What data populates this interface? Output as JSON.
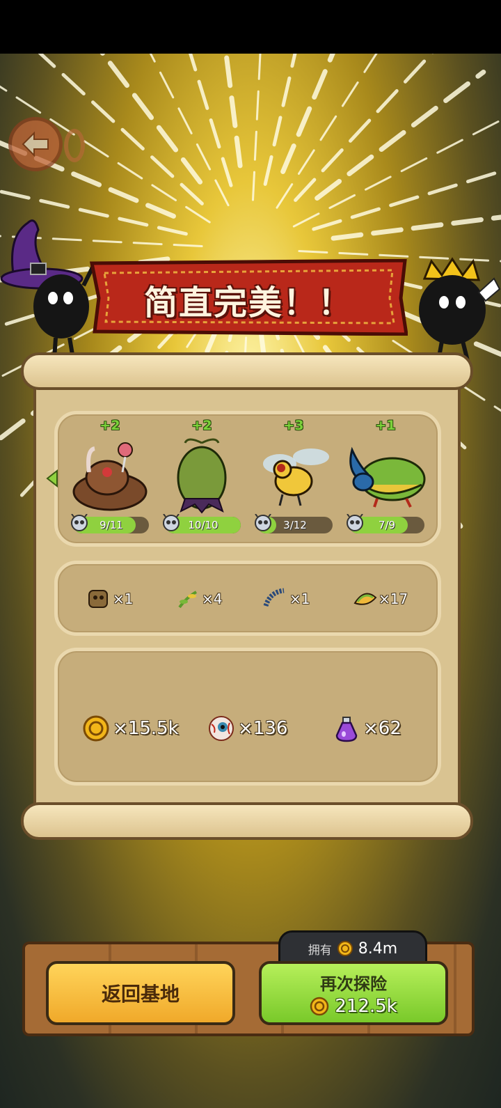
{
  "banner": {
    "title": "简直完美！！"
  },
  "monsters": [
    {
      "bonus": "+2",
      "progress": "9/11",
      "level": 0.82,
      "name": "candy-slime-monster-icon"
    },
    {
      "bonus": "+2",
      "progress": "10/10",
      "level": 1.0,
      "name": "green-egg-pod-monster-icon"
    },
    {
      "bonus": "+3",
      "progress": "3/12",
      "level": 0.25,
      "name": "yellow-fly-monster-icon"
    },
    {
      "bonus": "+1",
      "progress": "7/9",
      "level": 0.78,
      "name": "rhino-beetle-monster-icon"
    }
  ],
  "materials": [
    {
      "qty": "×1",
      "name": "shell-fragment-icon"
    },
    {
      "qty": "×4",
      "name": "plant-sprout-icon"
    },
    {
      "qty": "×1",
      "name": "centipede-icon"
    },
    {
      "qty": "×17",
      "name": "melon-slice-icon"
    }
  ],
  "currencies": [
    {
      "qty": "×15.5k",
      "name": "gold-coin-icon"
    },
    {
      "qty": "×136",
      "name": "eyeball-icon"
    },
    {
      "qty": "×62",
      "name": "purple-potion-icon"
    }
  ],
  "owned": {
    "label": "拥有",
    "value": "8.4m"
  },
  "buttons": {
    "home": "返回基地",
    "again": "再次探险",
    "again_cost": "212.5k"
  },
  "colors": {
    "progress_fill": "#8fd13f",
    "bonus_text": "#7bd23a",
    "banner_red": "#b9281a"
  }
}
